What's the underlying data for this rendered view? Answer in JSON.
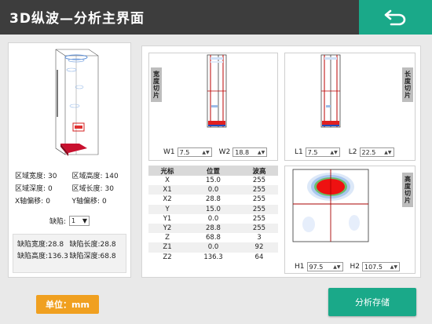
{
  "title": "3D纵波—分析主界面",
  "colors": {
    "titlebar": "#3d3d3d",
    "accent": "#1aa989",
    "unit_badge": "#f0a020"
  },
  "icons": {
    "back": "return-arrow-icon"
  },
  "region": {
    "width_label": "区域宽度:",
    "width_value": "30",
    "height_label": "区域高度:",
    "height_value": "140",
    "depth_label": "区域深度:",
    "depth_value": "0",
    "length_label": "区域长度:",
    "length_value": "30",
    "xoffset_label": "X轴偏移:",
    "xoffset_value": "0",
    "yoffset_label": "Y轴偏移:",
    "yoffset_value": "0"
  },
  "defect": {
    "select_label": "缺陷:",
    "select_value": "1",
    "width_label": "缺陷宽度:",
    "width_value": "28.8",
    "length_label": "缺陷长度:",
    "length_value": "28.8",
    "height_label": "缺陷高度:",
    "height_value": "136.3",
    "depth_label": "缺陷深度:",
    "depth_value": "68.8"
  },
  "slices": {
    "width": {
      "label": "宽度切片",
      "w1_label": "W1",
      "w1_value": "7.5",
      "w2_label": "W2",
      "w2_value": "18.8"
    },
    "length": {
      "label": "长度切片",
      "l1_label": "L1",
      "l1_value": "7.5",
      "l2_label": "L2",
      "l2_value": "22.5"
    },
    "height": {
      "label": "高度切片",
      "h1_label": "H1",
      "h1_value": "97.5",
      "h2_label": "H2",
      "h2_value": "107.5"
    }
  },
  "cursor_table": {
    "headers": [
      "光标",
      "位置",
      "波高"
    ],
    "rows": [
      [
        "X",
        "15.0",
        "255"
      ],
      [
        "X1",
        "0.0",
        "255"
      ],
      [
        "X2",
        "28.8",
        "255"
      ],
      [
        "Y",
        "15.0",
        "255"
      ],
      [
        "Y1",
        "0.0",
        "255"
      ],
      [
        "Y2",
        "28.8",
        "255"
      ],
      [
        "Z",
        "68.8",
        "3"
      ],
      [
        "Z1",
        "0.0",
        "92"
      ],
      [
        "Z2",
        "136.3",
        "64"
      ]
    ]
  },
  "unit": "单位：mm",
  "save_button": "分析存储"
}
